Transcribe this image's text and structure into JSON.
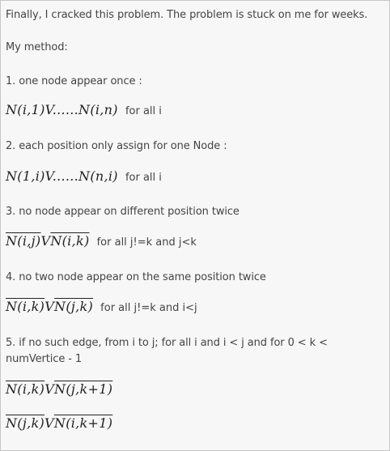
{
  "post": {
    "intro": "Finally, I cracked this problem. The problem is stuck on me for weeks.",
    "method_heading": "My method:",
    "c1": {
      "label": "1. one node appear once :",
      "formula": "N(i,1)V......N(i,n)",
      "suffix": "for all i"
    },
    "c2": {
      "label": "2. each position only assign for one Node :",
      "formula": "N(1,i)V......N(n,i)",
      "suffix": "for all i"
    },
    "c3": {
      "label": "3. no node appear on different position twice",
      "formula_a": "N(i,j)",
      "op": "V",
      "formula_b": "N(i,k)",
      "suffix": "for all j!=k and j<k"
    },
    "c4": {
      "label": "4. no two node appear on the same position twice",
      "formula_a": "N(i,k)",
      "op": "V",
      "formula_b": "N(j,k)",
      "suffix": "for all j!=k and i<j"
    },
    "c5": {
      "label": "5. if no such edge, from i to j; for all i and i < j and for 0 < k < numVertice - 1",
      "f1_a": "N(i,k)",
      "f1_op": "V",
      "f1_b": "N(j,k+1)",
      "f2_a": "N(j,k)",
      "f2_op": "V",
      "f2_b": "N(i,k+1)"
    }
  }
}
